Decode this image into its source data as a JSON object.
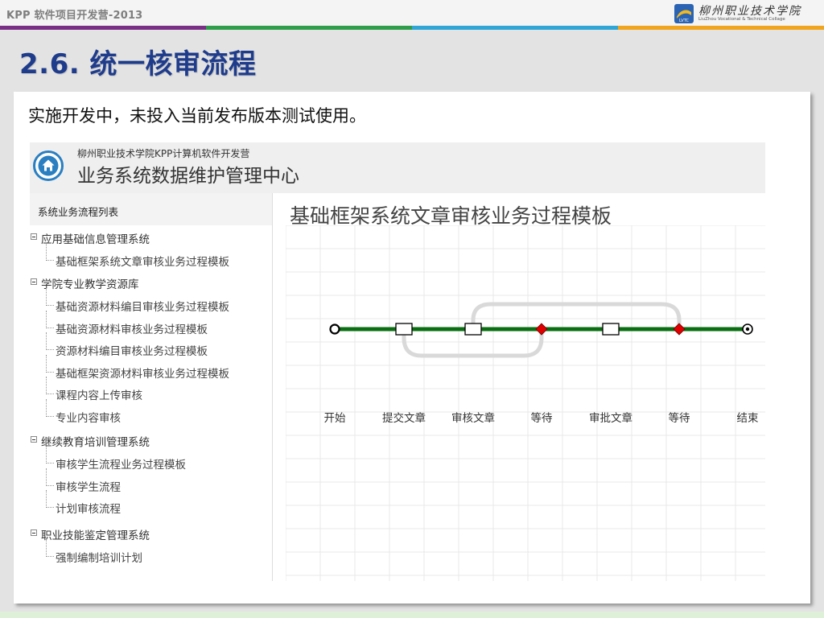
{
  "slide": {
    "header": "KPP 软件项目开发营-2013",
    "logo_cn": "柳州职业技术学院",
    "logo_en": "LiuZhou Vocational & Technical Collage",
    "logo_badge": "LVTC",
    "band_colors": [
      "#7a2f86",
      "#2e9e4a",
      "#2fa6d6",
      "#f0a51c"
    ],
    "title": "2.6. 统一核审流程",
    "intro": "实施开发中，未投入当前发布版本测试使用。"
  },
  "app": {
    "subtitle": "柳州职业技术学院KPP计算机软件开发营",
    "title": "业务系统数据维护管理中心",
    "home_icon": "home-icon",
    "sidebar": {
      "header": "系统业务流程列表",
      "groups": [
        {
          "label": "应用基础信息管理系统",
          "children": [
            "基础框架系统文章审核业务过程模板"
          ]
        },
        {
          "label": "学院专业教学资源库",
          "children": [
            "基础资源材料编目审核业务过程模板",
            "基础资源材料审核业务过程模板",
            "资源材料编目审核业务过程模板",
            "基础框架资源材料审核业务过程模板",
            "课程内容上传审核",
            "专业内容审核"
          ]
        },
        {
          "label": "继续教育培训管理系统",
          "children": [
            "审核学生流程业务过程模板",
            "审核学生流程",
            "计划审核流程"
          ]
        },
        {
          "label": "职业技能鉴定管理系统",
          "children": [
            "强制编制培训计划"
          ]
        }
      ]
    },
    "diagram": {
      "title": "基础框架系统文章审核业务过程模板",
      "nodes": [
        {
          "label": "开始",
          "shape": "start"
        },
        {
          "label": "提交文章",
          "shape": "task"
        },
        {
          "label": "审核文章",
          "shape": "task"
        },
        {
          "label": "等待",
          "shape": "gateway"
        },
        {
          "label": "审批文章",
          "shape": "task"
        },
        {
          "label": "等待",
          "shape": "gateway"
        },
        {
          "label": "结束",
          "shape": "end"
        }
      ],
      "line_color": "#0a6e12",
      "gateway_color": "#e00000",
      "loop_color": "#d9d9d9"
    }
  }
}
